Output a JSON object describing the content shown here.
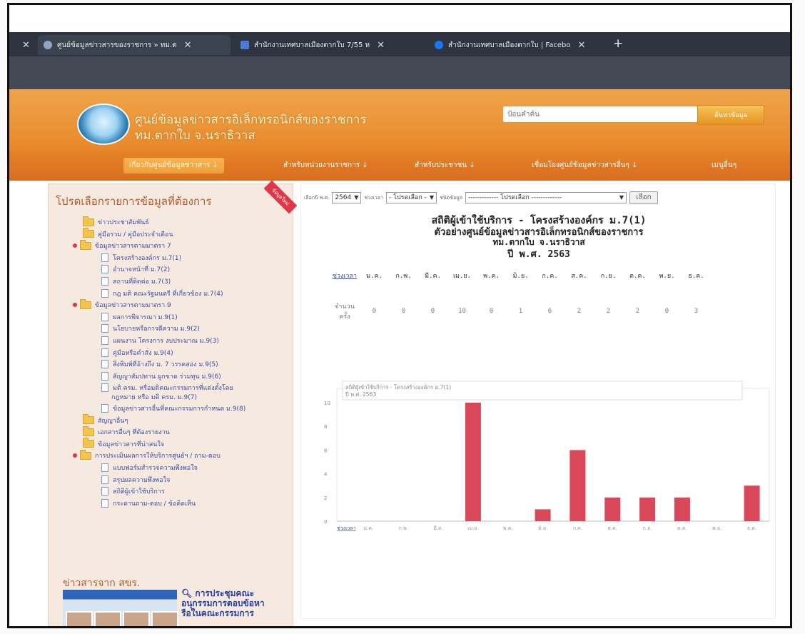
{
  "browser": {
    "tabs": [
      {
        "label": "ศูนย์ข้อมูลข่าวสารของราชการ » ทม.ต"
      },
      {
        "label": "สำนักงานเทศบาลเมืองตากใบ 7/55 ห"
      },
      {
        "label": "สำนักงานเทศบาลเมืองตากใบ | Facebo"
      }
    ]
  },
  "header": {
    "title_line1": "ศูนย์ข้อมูลข่าวสารอิเล็กทรอนิกส์ของราชการ",
    "title_line2": "ทม.ตากใบ จ.นราธิวาส",
    "search_placeholder": "ป้อนคำค้น",
    "search_button": "ค้นหาข้อมูล"
  },
  "nav": [
    "เกี่ยวกับศูนย์ข้อมูลข่าวสาร",
    "สำหรับหน่วยงานราชการ",
    "สำหรับประชาชน",
    "เชื่อมโยงศูนย์ข้อมูลข่าวสารอื่นๆ",
    "เมนูอื่นๆ"
  ],
  "sidebar": {
    "title": "โปรดเลือกรายการข้อมูลที่ต้องการ",
    "ribbon": "ข้อมูลใหม่",
    "menu": [
      {
        "type": "folder",
        "label": "ข่าวประชาสัมพันธ์"
      },
      {
        "type": "folder",
        "label": "คู่มือรวม / คู่มือประจำเดือน"
      },
      {
        "type": "open-folder",
        "label": "ข้อมูลข่าวสารตามมาตรา 7"
      },
      {
        "type": "doc",
        "label": "โครงสร้างองค์กร ม.7(1)"
      },
      {
        "type": "doc",
        "label": "อำนาจหน้าที่ ม.7(2)"
      },
      {
        "type": "doc",
        "label": "สถานที่ติดต่อ ม.7(3)"
      },
      {
        "type": "doc",
        "label": "กฎ มติ คณะรัฐมนตรี ที่เกี่ยวข้อง ม.7(4)"
      },
      {
        "type": "open-folder",
        "label": "ข้อมูลข่าวสารตามมาตรา 9"
      },
      {
        "type": "doc",
        "label": "ผลการพิจารณา ม.9(1)"
      },
      {
        "type": "doc",
        "label": "นโยบายหรือการตีความ ม.9(2)"
      },
      {
        "type": "doc",
        "label": "แผนงาน โครงการ งบประมาณ ม.9(3)"
      },
      {
        "type": "doc",
        "label": "คู่มือหรือคำสั่ง ม.9(4)"
      },
      {
        "type": "doc",
        "label": "สิ่งพิมพ์ที่อ้างถึง ม. 7 วรรคสอง ม.9(5)"
      },
      {
        "type": "doc",
        "label": "สัญญาสัมปทาน ผูกขาด ร่วมทุน ม.9(6)"
      },
      {
        "type": "doc2",
        "label": "มติ ครม. หรือมติคณะกรรมการที่แต่งตั้งโดย",
        "label2": "กฎหมาย หรือ มติ ครม. ม.9(7)"
      },
      {
        "type": "doc",
        "label": "ข้อมูลข่าวสารอื่นที่คณะกรรมการกำหนด ม.9(8)"
      },
      {
        "type": "folder",
        "label": "สัญญาอื่นๆ"
      },
      {
        "type": "folder",
        "label": "เอกสารอื่นๆ ที่ต้องรายงาน"
      },
      {
        "type": "folder",
        "label": "ข้อมูลข่าวสารที่น่าสนใจ"
      },
      {
        "type": "open-folder",
        "label": "การประเมินผลการให้บริการศูนย์ฯ / ถาม-ตอบ"
      },
      {
        "type": "doc",
        "label": "แบบฟอร์มสำรวจความพึงพอใจ"
      },
      {
        "type": "doc",
        "label": "สรุปผลความพึงพอใจ"
      },
      {
        "type": "doc",
        "label": "สถิติผู้เข้าใช้บริการ"
      },
      {
        "type": "doc",
        "label": "กระดานถาม-ตอบ / ข้อคิดเห็น"
      }
    ],
    "news_title": "ข่าวสารจาก สขร.",
    "news_headline": "การประชุมคณะอนุกรรมการตอบข้อหารือในคณะกรรมการ"
  },
  "filters": {
    "year_label": "เลือกปี พ.ศ.",
    "year_value": "2564",
    "period_label": "ช่วงเวลา",
    "period_value": "- โปรดเลือก -",
    "type_label": "ชนิดข้อมูล",
    "type_value": "------------- โปรดเลือก -------------",
    "button": "เลือก"
  },
  "report": {
    "title": "สถิติผู้เข้าใช้บริการ - โครงสร้างองค์กร ม.7(1)",
    "subtitle": "ตัวอย่างศูนย์ข้อมูลข่าวสารอิเล็กทรอนิกส์ของราชการ",
    "agency": "ทม.ตากใบ จ.นราธิวาส",
    "year": "ปี พ.ศ. 2563"
  },
  "table": {
    "corner_label": "ช่วงเวลา",
    "row_label": "จำนวนครั้ง"
  },
  "chart_data": {
    "type": "bar",
    "title": "สถิติผู้เข้าใช้บริการ - โครงสร้างองค์กร ม.7(1) ตัวอย่างศูนย์ข้อมูลข่าวสารอิเล็กทรอนิกส์ของราชการ ทม.ตากใบ จ.นราธิวาส ปี พ.ศ. 2563",
    "xlabel": "ช่วงเวลา",
    "ylabel": "",
    "categories": [
      "ม.ค.",
      "ก.พ.",
      "มี.ค.",
      "เม.ย.",
      "พ.ค.",
      "มิ.ย.",
      "ก.ค.",
      "ส.ค.",
      "ก.ย.",
      "ต.ค.",
      "พ.ย.",
      "ธ.ค."
    ],
    "values": [
      0,
      0,
      0,
      10,
      0,
      1,
      6,
      2,
      2,
      2,
      0,
      3
    ],
    "ylim": [
      0,
      10
    ],
    "yticks": [
      0,
      2,
      4,
      6,
      8,
      10
    ],
    "bar_color": "#d9475a",
    "grid": false,
    "legend": "none"
  }
}
